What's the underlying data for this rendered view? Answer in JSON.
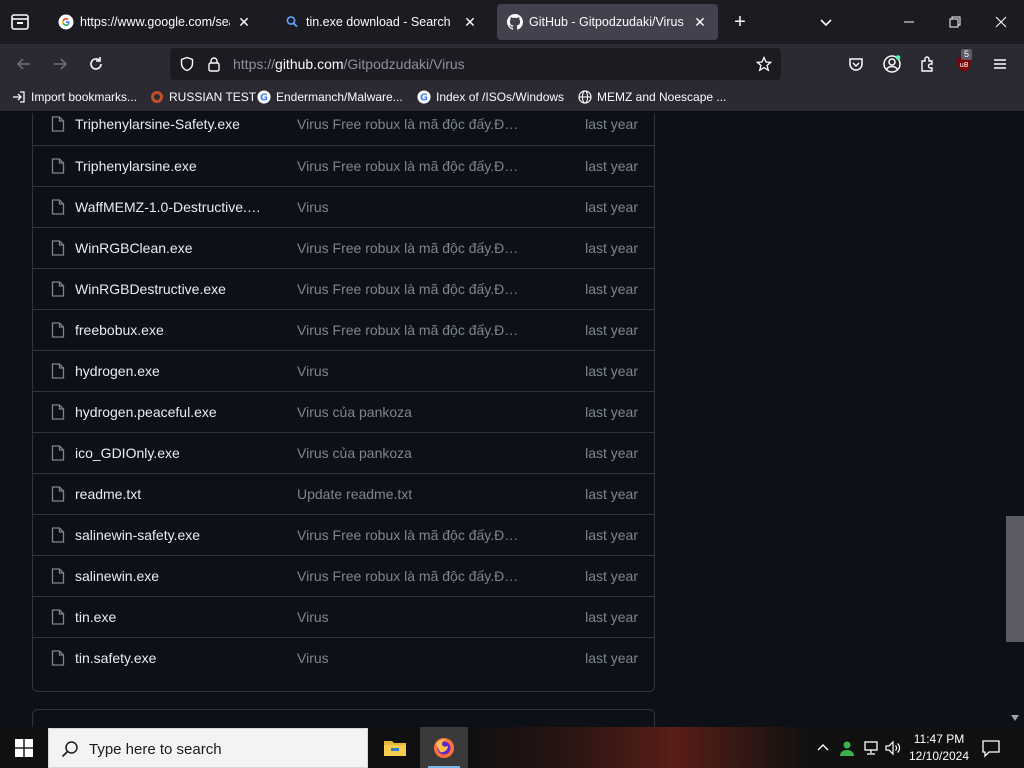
{
  "browser": {
    "tabs": [
      {
        "title": "https://www.google.com/searc",
        "favicon": "google-icon",
        "active": false
      },
      {
        "title": "tin.exe download - Search",
        "favicon": "search-icon",
        "active": false
      },
      {
        "title": "GitHub - Gitpodzudaki/Virus",
        "favicon": "github-icon",
        "active": true
      }
    ],
    "url_prefix": "https://",
    "url_host": "github.com",
    "url_path": "/Gitpodzudaki/Virus",
    "extension_badge": "5"
  },
  "bookmarks": [
    {
      "label": "Import bookmarks...",
      "icon": "import-icon"
    },
    {
      "label": "RUSSIAN TEST",
      "icon": "site-icon"
    },
    {
      "label": "Endermanch/Malware...",
      "icon": "google-icon"
    },
    {
      "label": "Index of /ISOs/Windows",
      "icon": "google-icon"
    },
    {
      "label": "MEMZ and Noescape ...",
      "icon": "globe-icon"
    }
  ],
  "files": [
    {
      "name": "Triphenylarsine-Safety.exe",
      "message": "Virus Free robux là mã độc đấy.Đừ...",
      "date": "last year"
    },
    {
      "name": "Triphenylarsine.exe",
      "message": "Virus Free robux là mã độc đấy.Đừ...",
      "date": "last year"
    },
    {
      "name": "WaffMEMZ-1.0-Destructive.e...",
      "message": "Virus",
      "date": "last year"
    },
    {
      "name": "WinRGBClean.exe",
      "message": "Virus Free robux là mã độc đấy.Đừ...",
      "date": "last year"
    },
    {
      "name": "WinRGBDestructive.exe",
      "message": "Virus Free robux là mã độc đấy.Đừ...",
      "date": "last year"
    },
    {
      "name": "freebobux.exe",
      "message": "Virus Free robux là mã độc đấy.Đừ...",
      "date": "last year"
    },
    {
      "name": "hydrogen.exe",
      "message": "Virus",
      "date": "last year"
    },
    {
      "name": "hydrogen.peaceful.exe",
      "message": "Virus của pankoza",
      "date": "last year"
    },
    {
      "name": "ico_GDIOnly.exe",
      "message": "Virus của pankoza",
      "date": "last year"
    },
    {
      "name": "readme.txt",
      "message": "Update readme.txt",
      "date": "last year"
    },
    {
      "name": "salinewin-safety.exe",
      "message": "Virus Free robux là mã độc đấy.Đừ...",
      "date": "last year"
    },
    {
      "name": "salinewin.exe",
      "message": "Virus Free robux là mã độc đấy.Đừ...",
      "date": "last year"
    },
    {
      "name": "tin.exe",
      "message": "Virus",
      "date": "last year"
    },
    {
      "name": "tin.safety.exe",
      "message": "Virus",
      "date": "last year"
    }
  ],
  "taskbar": {
    "search_placeholder": "Type here to search",
    "time": "11:47 PM",
    "date": "12/10/2024"
  },
  "colors": {
    "page_bg": "#0d1117",
    "border": "#30363d",
    "text": "#e6edf3",
    "muted": "#7d8590"
  }
}
